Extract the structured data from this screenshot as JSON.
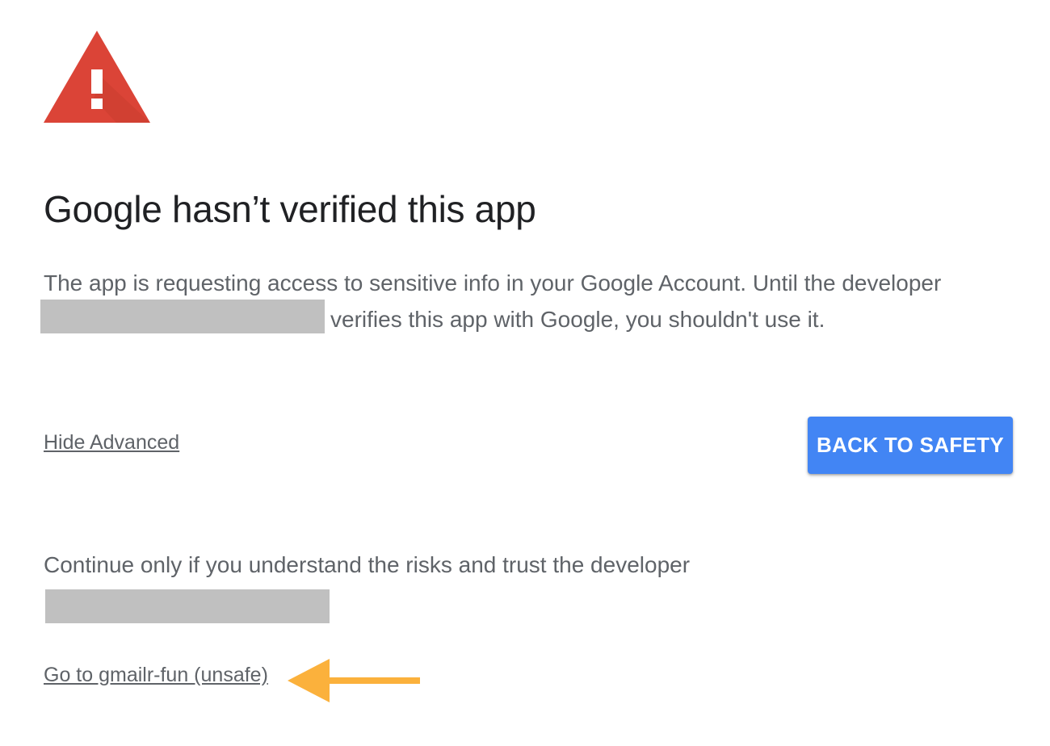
{
  "header": {
    "icon": "warning-triangle-icon",
    "icon_color": "#db4437"
  },
  "main": {
    "title": "Google hasn’t verified this app",
    "message_line1": "The app is requesting access to sensitive info in your Google Account. Until the developer",
    "message_line2": "verifies this app with Google, you shouldn't use it.",
    "hide_advanced_label": "Hide Advanced",
    "back_button_label": "BACK TO SAFETY",
    "continue_text": "Continue only if you understand the risks and trust the developer",
    "go_to_link_label": "Go to gmailr-fun (unsafe)"
  },
  "annotation": {
    "arrow_icon": "arrow-left-icon",
    "arrow_color": "#fbb13c"
  },
  "colors": {
    "accent": "#4285f4",
    "text": "#5f6368",
    "title": "#202124",
    "redaction": "#c0c0c0"
  }
}
